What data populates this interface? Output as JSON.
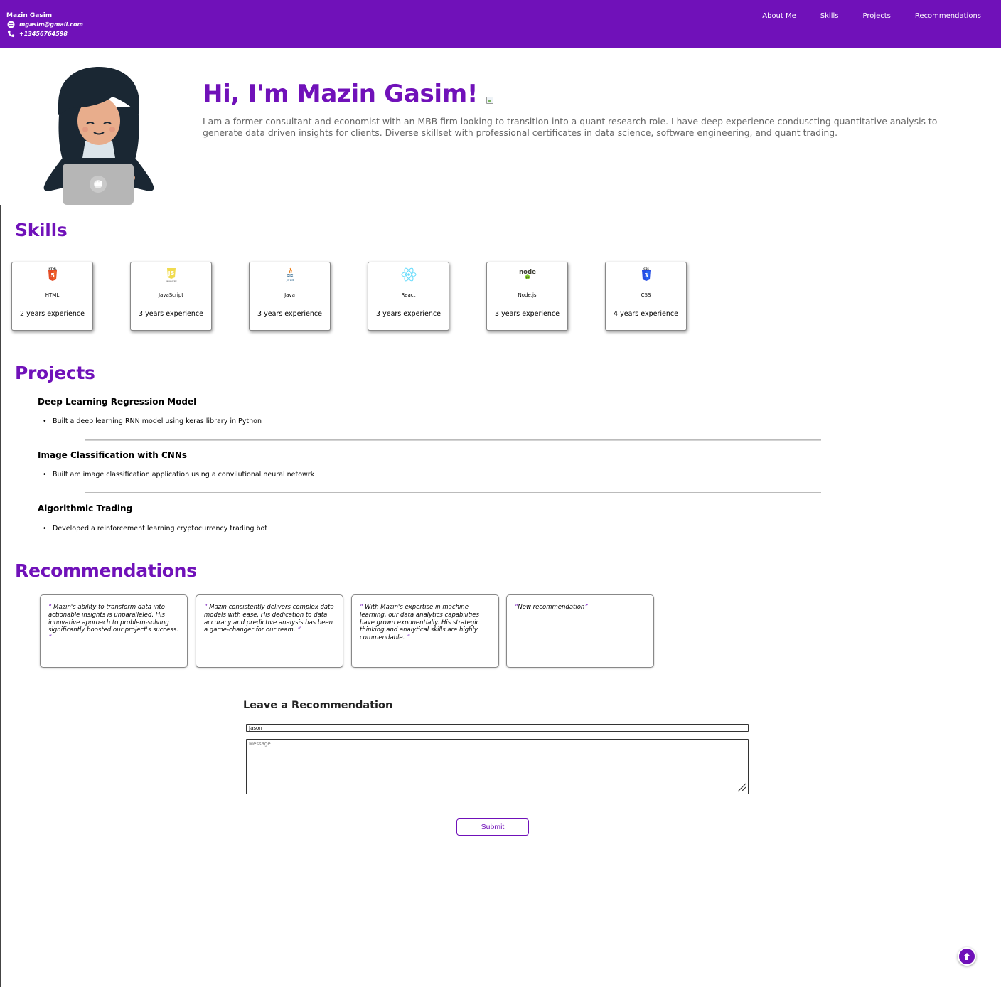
{
  "header": {
    "brand": "Mazin Gasim",
    "email": "mgasim@gmail.com",
    "phone": "+13456764598",
    "nav": [
      "About Me",
      "Skills",
      "Projects",
      "Recommendations"
    ]
  },
  "hero": {
    "title": "Hi, I'm Mazin Gasim!",
    "text": "I am a former consultant and economist with an MBB firm looking to transition into a quant research role. I have deep experience conduscting quantitative analysis to generate data driven insights for clients. Diverse skillset with professional certificates in data science, software engineering, and quant trading."
  },
  "skills": {
    "title": "Skills",
    "items": [
      {
        "name": "HTML",
        "experience": "2 years experience",
        "icon": "html5-icon"
      },
      {
        "name": "JavaScript",
        "experience": "3 years experience",
        "icon": "javascript-icon"
      },
      {
        "name": "Java",
        "experience": "3 years experience",
        "icon": "java-icon"
      },
      {
        "name": "React",
        "experience": "3 years experience",
        "icon": "react-icon"
      },
      {
        "name": "Node.js",
        "experience": "3 years experience",
        "icon": "nodejs-icon"
      },
      {
        "name": "CSS",
        "experience": "4 years experience",
        "icon": "css3-icon"
      }
    ]
  },
  "projects": {
    "title": "Projects",
    "items": [
      {
        "title": "Deep Learning Regression Model",
        "detail": "Built a deep learning RNN model using keras library in Python"
      },
      {
        "title": "Image Classification with CNNs",
        "detail": "Built am image classification application using a convilutional neural netowrk"
      },
      {
        "title": "Algorithmic Trading",
        "detail": "Developed a reinforcement learning cryptocurrency trading bot"
      }
    ]
  },
  "recommendations": {
    "title": "Recommendations",
    "items": [
      {
        "open": "“",
        "text": " Mazin's ability to transform data into actionable insights is unparalleled. His innovative approach to problem-solving significantly boosted our project's success. ",
        "close": "”"
      },
      {
        "open": "“",
        "text": " Mazin consistently delivers complex data models with ease. His dedication to data accuracy and predictive analysis has been a game-changer for our team. ",
        "close": "”"
      },
      {
        "open": "“",
        "text": " With Mazin's expertise in machine learning, our data analytics capabilities have grown exponentially. His strategic thinking and analytical skills are highly commendable. ",
        "close": "”"
      },
      {
        "open": "“",
        "text": "New recommendation",
        "close": "”"
      }
    ],
    "form": {
      "title": "Leave a Recommendation",
      "name_value": "Jason",
      "message_placeholder": "Message",
      "submit_label": "Submit"
    }
  },
  "colors": {
    "brand": "#7011b9"
  }
}
